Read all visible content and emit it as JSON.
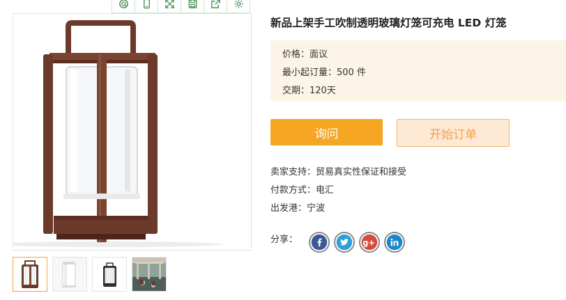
{
  "toolbar": {
    "icons": [
      "zoom-search-icon",
      "phone-icon",
      "expand-icon",
      "save-icon",
      "share-export-icon",
      "settings-icon"
    ]
  },
  "product": {
    "title": "新品上架手工吹制透明玻璃灯笼可充电 LED 灯笼"
  },
  "info": {
    "price": "价格：面议",
    "moq": "最小起订量：500 件",
    "delivery": "交期：120天"
  },
  "buttons": {
    "inquiry": "询问",
    "order": "开始订单"
  },
  "details": {
    "seller_support": "卖家支持：贸易真实性保证和接受",
    "payment": "付款方式：电汇",
    "port": "出发港：宁波"
  },
  "share": {
    "label": "分享：",
    "networks": [
      "facebook-icon",
      "twitter-icon",
      "google-plus-icon",
      "linkedin-icon"
    ]
  },
  "colors": {
    "accent": "#f5a623",
    "info_bg": "#fdf4e8",
    "frame_brown": "#6b3a2a",
    "facebook": "#3b5998",
    "twitter": "#2d9fd9",
    "google_plus": "#d64b3c",
    "linkedin": "#1e88c7"
  }
}
